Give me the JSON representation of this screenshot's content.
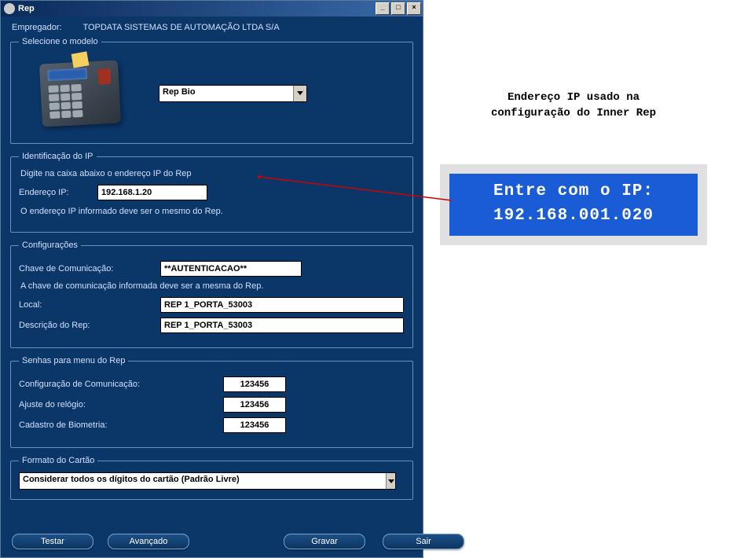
{
  "titlebar": {
    "title": "Rep"
  },
  "employer": {
    "label": "Empregador:",
    "value": "TOPDATA SISTEMAS DE AUTOMAÇÃO LTDA S/A"
  },
  "model": {
    "legend": "Selecione o modelo",
    "selected": "Rep Bio"
  },
  "ip": {
    "legend": "Identificação do IP",
    "hint_top": "Digite na caixa abaixo o endereço IP do Rep",
    "label": "Endereço IP:",
    "value": "192.168.1.20",
    "hint_bottom": "O endereço IP informado deve ser o mesmo do Rep."
  },
  "config": {
    "legend": "Configurações",
    "comm_key_label": "Chave de Comunicação:",
    "comm_key_value": "**AUTENTICACAO**",
    "comm_key_hint": "A chave de comunicação informada deve ser a mesma do Rep.",
    "local_label": "Local:",
    "local_value": "REP 1_PORTA_53003",
    "desc_label": "Descrição do Rep:",
    "desc_value": "REP 1_PORTA_53003"
  },
  "passwords": {
    "legend": "Senhas para menu do Rep",
    "comm_label": "Configuração de Comunicação:",
    "comm_value": "123456",
    "clock_label": "Ajuste do relógio:",
    "clock_value": "123456",
    "bio_label": "Cadastro de Biometria:",
    "bio_value": "123456"
  },
  "card": {
    "legend": "Formato do Cartão",
    "selected": "Considerar todos os dígitos do cartão (Padrão Livre)"
  },
  "buttons": {
    "test": "Testar",
    "advanced": "Avançado",
    "save": "Gravar",
    "exit": "Sair"
  },
  "annotation": {
    "text_line1": "Endereço IP usado na",
    "text_line2": "configuração do Inner Rep",
    "lcd_line1": "Entre  com o IP:",
    "lcd_line2": "192.168.001.020"
  }
}
